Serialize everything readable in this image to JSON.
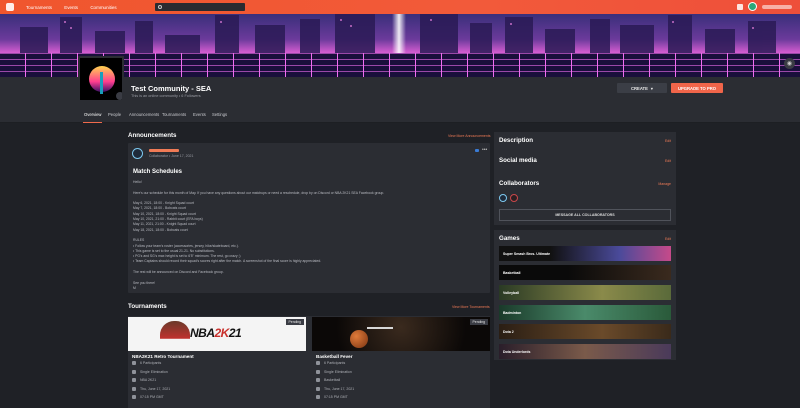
{
  "topnav": {
    "items": [
      "Tournaments",
      "Events",
      "Communities"
    ]
  },
  "community": {
    "name": "Test Community - SEA",
    "subtitle": "This is an online community  •  6 Followers"
  },
  "header_buttons": {
    "create": "CREATE",
    "upgrade": "UPGRADE TO PRO"
  },
  "tabs": [
    "Overview",
    "People",
    "Announcements",
    "Tournaments",
    "Events",
    "Settings"
  ],
  "announcements": {
    "heading": "Announcements",
    "view_more": "View More Announcements",
    "post": {
      "role": "Collaborator  •  June 17, 2021",
      "title": "Match Schedules",
      "body": [
        "Hello!",
        "",
        "Here's our schedule for this month of May. If you have any questions about our matchups or need a reschedule, drop by on Discord or NBA 2K21 SEA Facebook group.",
        "",
        "May 6, 2021, 18:00 - Knight Squad court",
        "May 7, 2021, 18:00 - Bobcats court",
        "May 10, 2021, 18:00 - Knight Squad court",
        "May 10, 2021, 21:00 - Rabbit court (EFA boys)",
        "May 11, 2021, 21:00 - Knight Squad court",
        "May 18, 2021, 18:00 - Bobcats court",
        "",
        "RULES",
        "• Follow your team's roster (accessories, jersey, hike/skateboard, etc.).",
        "• This game is set to the usual 21-21. No substitutions.",
        "• PG's and SG's max height is set to 6'5\" minimum. The rest, go crazy ;)",
        "• Team Captains should record their squad's scores right after the match. A screenshot of the final score is highly appreciated.",
        "",
        "The rest will be announced on Discord and Facebook group.",
        "",
        "See you there!",
        "M"
      ]
    }
  },
  "tournaments": {
    "heading": "Tournaments",
    "view_more": "View More Tournaments",
    "cards": [
      {
        "title": "NBA2K21 Retro Tournament",
        "status": "Pending",
        "banner_text_a": "NBA",
        "banner_text_b": "2K",
        "banner_text_c": "21",
        "participants": "6 Participants",
        "format": "Single Elimination",
        "game": "NBA 2K21",
        "date": "Thu, June 17, 2021",
        "time": "07:15 PM GMT"
      },
      {
        "title": "Basketball Fever",
        "status": "Pending",
        "participants": "6 Participants",
        "format": "Single Elimination",
        "game": "Basketball",
        "date": "Thu, June 17, 2021",
        "time": "07:15 PM GMT"
      }
    ]
  },
  "sidebar": {
    "description": {
      "title": "Description",
      "action": "Edit"
    },
    "social": {
      "title": "Social media",
      "action": "Edit"
    },
    "collaborators": {
      "title": "Collaborators",
      "action": "Manage",
      "button": "MESSAGE ALL COLLABORATORS"
    },
    "games": {
      "title": "Games",
      "action": "Edit",
      "items": [
        "Super Smash Bros. Ultimate",
        "Basketball",
        "Volleyball",
        "Badminton",
        "Dota 2",
        "Dota Underlords"
      ]
    }
  },
  "colors": {
    "accent": "#f06a4c",
    "topbar": "#f0562d",
    "background": "#1f2126",
    "panel": "#2b2d33"
  }
}
